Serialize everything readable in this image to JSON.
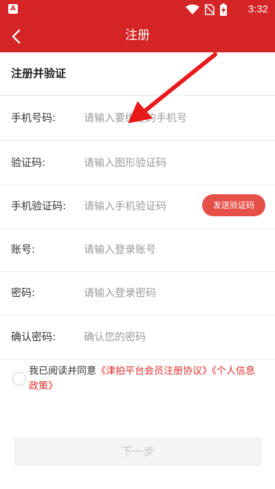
{
  "status_bar": {
    "left_icon_text": "A",
    "time": "3:32",
    "icons": [
      "wifi-icon",
      "no-sim-icon",
      "battery-charging-icon"
    ]
  },
  "app_bar": {
    "title": "注册",
    "back_icon": "chevron-left-icon"
  },
  "section": {
    "title": "注册并验证"
  },
  "form": {
    "phone": {
      "label": "手机号码:",
      "placeholder": "请输入要绑定的手机号"
    },
    "captcha": {
      "label": "验证码:",
      "placeholder": "请输入图形验证码"
    },
    "sms_code": {
      "label": "手机验证码:",
      "placeholder": "请输入手机验证码",
      "send_button": "发送验证码"
    },
    "account": {
      "label": "账号:",
      "placeholder": "请输入登录账号"
    },
    "password": {
      "label": "密码:",
      "placeholder": "请输入登录密码"
    },
    "confirm_password": {
      "label": "确认密码:",
      "placeholder": "确认您的密码"
    }
  },
  "agreement": {
    "prefix": "我已阅读并同意",
    "link1": "《津拍平台会员注册协议》",
    "link2": "《个人信息政策》"
  },
  "next_button": "下一步",
  "colors": {
    "brand_red": "#d42426",
    "send_button": "#e65049",
    "link_red": "#e12d2d",
    "disabled_button_bg": "#f4f4f4"
  }
}
